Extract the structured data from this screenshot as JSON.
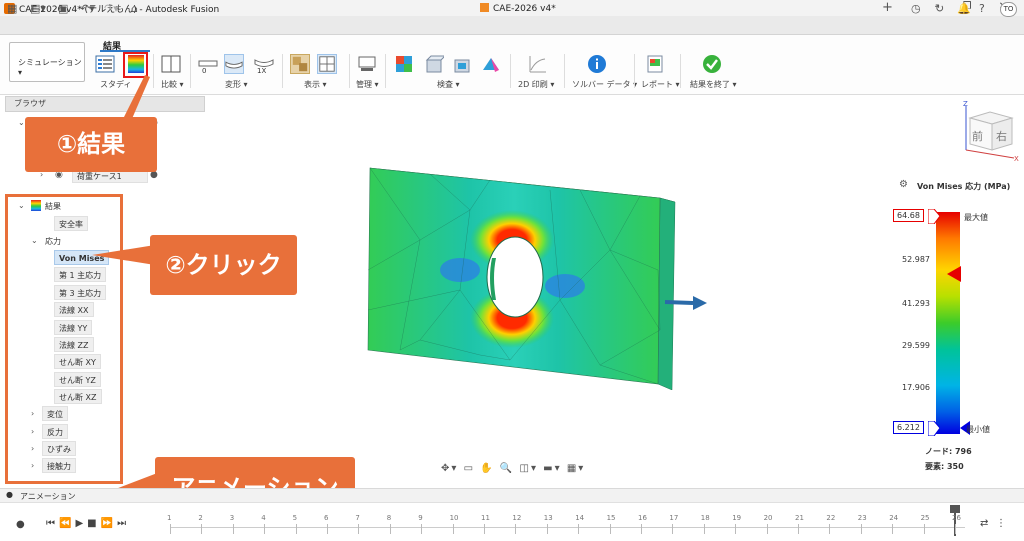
{
  "window": {
    "title": "CAE-2026 v4* (テルえもん) - Autodesk Fusion",
    "minimize": "–",
    "maximize": "❐",
    "close": "✕"
  },
  "tabbar": {
    "doc_tab": "CAE-2026 v4*",
    "user": "TO"
  },
  "ribbon": {
    "workspace": "シミュレーション",
    "active_tab": "結果",
    "groups": {
      "study": "スタディ",
      "compare": "比較",
      "deform": "変形",
      "display": "表示",
      "manage": "管理",
      "inspect": "検査",
      "print2d": "2D 印刷",
      "solver_data": "ソルバー データ",
      "report": "レポート",
      "finish": "結果を終了"
    },
    "deform_values": [
      "0",
      "1X"
    ]
  },
  "browser": {
    "title": "ブラウザ",
    "load_case": "荷重ケース1",
    "results": {
      "label": "結果",
      "items": [
        "安全率",
        "応力"
      ],
      "stress_children": [
        "Von Mises",
        "第 1 主応力",
        "第 3 主応力",
        "法線 XX",
        "法線 YY",
        "法線 ZZ",
        "せん断 XY",
        "せん断 YZ",
        "せん断 XZ"
      ],
      "other": [
        "変位",
        "反力",
        "ひずみ",
        "接触力"
      ]
    }
  },
  "callouts": {
    "result": "①結果",
    "click": "②クリック",
    "animation": "アニメーション"
  },
  "viewcube": {
    "front": "前",
    "right": "右",
    "z": "Z",
    "x": "X"
  },
  "legend": {
    "title": "Von Mises 応力 (MPa)",
    "max_label": "最大値",
    "min_label": "最小値",
    "max_value": "64.68",
    "min_value": "6.212",
    "ticks": [
      "52.987",
      "41.293",
      "29.599",
      "17.906"
    ],
    "nodes": "ノード: 796",
    "elements": "要素: 350",
    "colors": {
      "max": "#e60000",
      "min": "#0000e0"
    }
  },
  "animation": {
    "label": "アニメーション",
    "frames": [
      "1",
      "2",
      "3",
      "4",
      "5",
      "6",
      "7",
      "8",
      "9",
      "10",
      "11",
      "12",
      "13",
      "14",
      "15",
      "16",
      "17",
      "18",
      "19",
      "20",
      "21",
      "22",
      "23",
      "24",
      "25",
      "26"
    ]
  }
}
